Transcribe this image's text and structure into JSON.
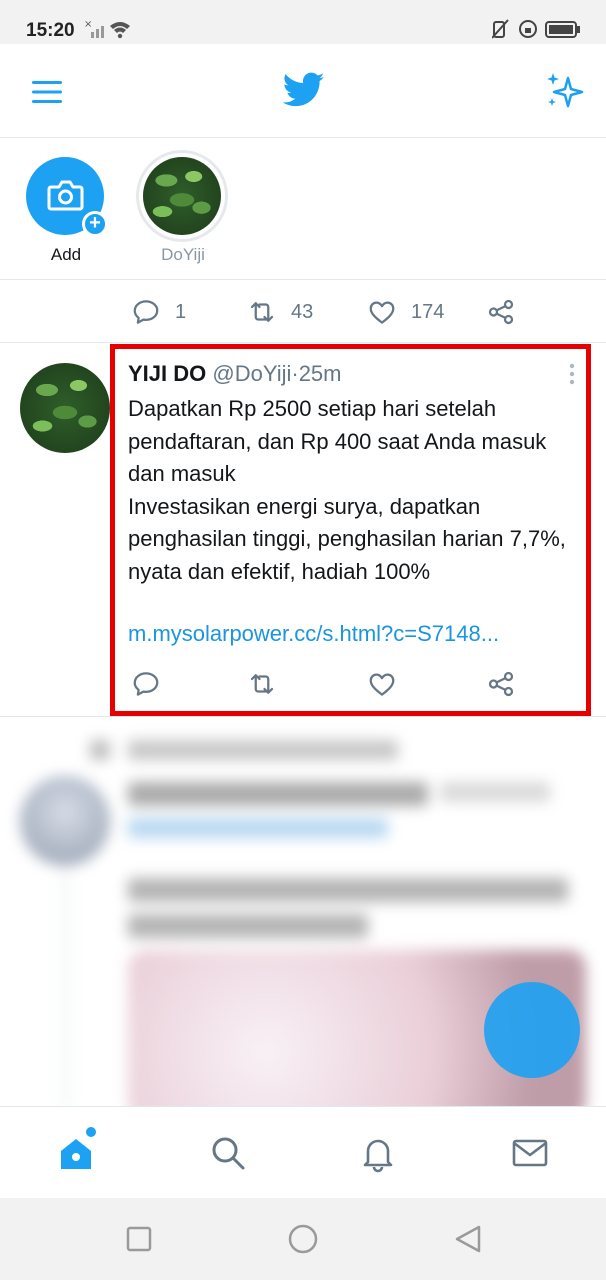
{
  "status_bar": {
    "time": "15:20"
  },
  "top_bar": {
    "menu_icon": "hamburger-menu-icon",
    "logo_icon": "twitter-bird-icon",
    "sparkle_icon": "sparkle-icon",
    "accent_color": "#1da1f2"
  },
  "fleets": {
    "add_label": "Add",
    "user_label": "DoYiji"
  },
  "previous_tweet": {
    "replies": "1",
    "retweets": "43",
    "likes": "174"
  },
  "tweet": {
    "name": "YIJI DO",
    "handle": "@DoYiji",
    "separator": "·",
    "time": "25m",
    "text": "Dapatkan Rp 2500 setiap hari setelah pendaftaran, dan Rp 400 saat Anda masuk dan masuk\nInvestasikan energi surya, dapatkan penghasilan tinggi, penghasilan harian 7,7%, nyata dan efektif, hadiah 100%",
    "link": "m.mysolarpower.cc/s.html?c=S7148...",
    "highlight_color": "#e60000"
  },
  "bottom_nav": {
    "items": [
      "home-icon",
      "search-icon",
      "notifications-icon",
      "messages-icon"
    ]
  }
}
